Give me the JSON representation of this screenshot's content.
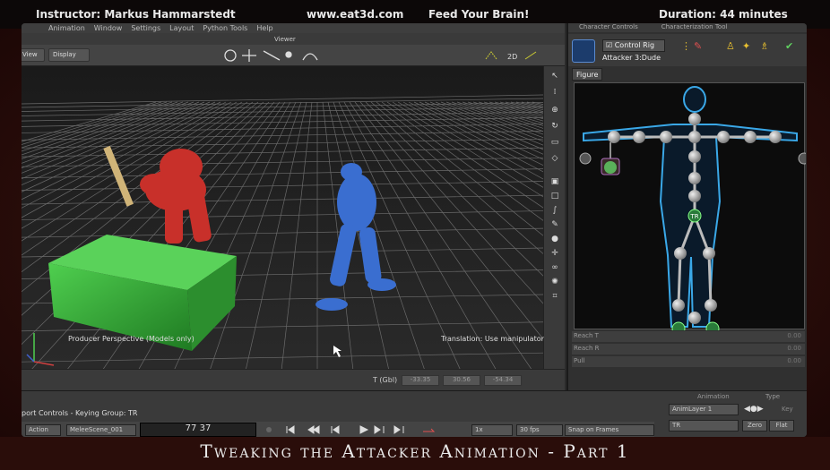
{
  "header": {
    "instructor": "Instructor: Markus Hammarstedt",
    "site": "www.eat3d.com",
    "slogan": "Feed Your Brain!",
    "duration": "Duration: 44 minutes"
  },
  "viewer": {
    "menu": [
      "Animation",
      "Window",
      "Settings",
      "Layout",
      "Python Tools",
      "Help"
    ],
    "label": "Viewer",
    "view_btn": "View",
    "display_btn": "Display",
    "perspective_label": "Producer Perspective (Models only)",
    "translation_label": "Translation: Use manipulator",
    "coord_label": "T (Gbl)",
    "coords": [
      "-33.35",
      "30.56",
      "-54.34"
    ]
  },
  "right_panel": {
    "tabs": [
      "Character Controls",
      "Characterization Tool"
    ],
    "rig_label": "Control Rig",
    "character": "Attacker 3:Dude",
    "figure_tab": "Figure",
    "props": [
      {
        "label": "Reach T",
        "value": "0.00"
      },
      {
        "label": "Reach R",
        "value": "0.00"
      },
      {
        "label": "Pull",
        "value": "0.00"
      }
    ],
    "tr_badge": "TR"
  },
  "bottom": {
    "transport_label": "port Controls  -  Keying Group: TR",
    "action": "Action",
    "scene": "MeleeScene_001",
    "timecode": "77 37",
    "step": "1x",
    "fps": "30 fps",
    "snap": "Snap on Frames",
    "anim_header": "Animation",
    "type_label": "Type",
    "layer": "AnimLayer 1",
    "key_label": "Key",
    "group": "TR",
    "zero_btn": "Zero",
    "flat_btn": "Flat"
  },
  "title": "Tweaking the Attacker Animation - Part 1"
}
